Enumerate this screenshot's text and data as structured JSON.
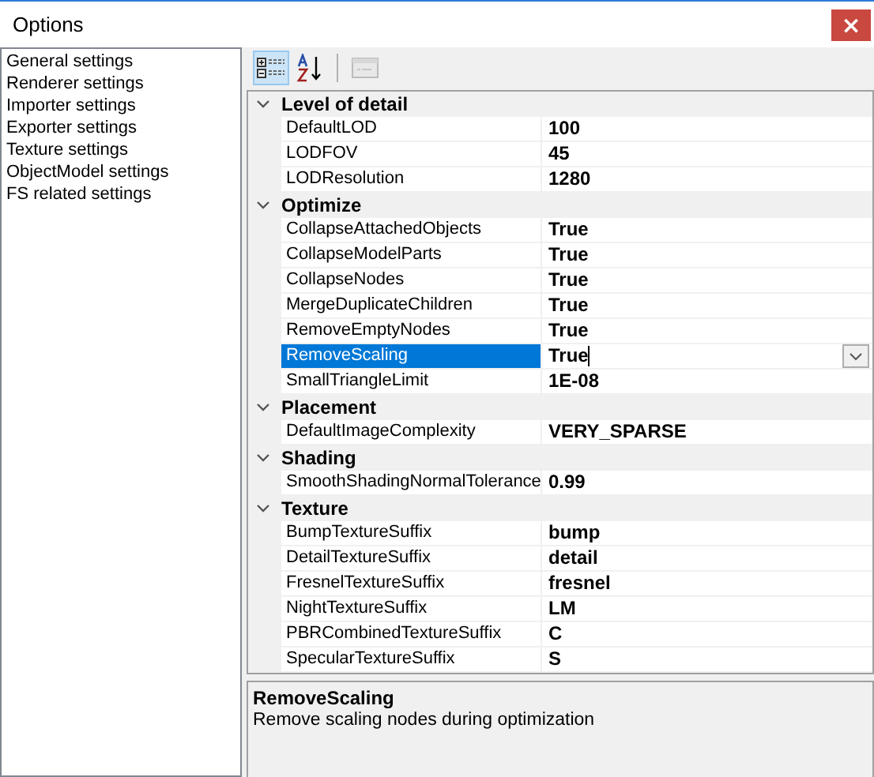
{
  "window": {
    "title": "Options",
    "close": "×"
  },
  "sidebar": {
    "items": [
      "General settings",
      "Renderer settings",
      "Importer settings",
      "Exporter settings",
      "Texture settings",
      "ObjectModel settings",
      "FS related settings"
    ]
  },
  "toolbar": [
    {
      "kind": "categorized",
      "selected": true,
      "disabled": false
    },
    {
      "kind": "alphabetical",
      "selected": false,
      "disabled": false
    },
    {
      "kind": "pages",
      "selected": false,
      "disabled": true
    }
  ],
  "grid": {
    "categories": [
      {
        "name": "Level of detail",
        "expanded": true,
        "properties": [
          {
            "name": "DefaultLOD",
            "value": "100",
            "selected": false
          },
          {
            "name": "LODFOV",
            "value": "45",
            "selected": false
          },
          {
            "name": "LODResolution",
            "value": "1280",
            "selected": false
          }
        ]
      },
      {
        "name": "Optimize",
        "expanded": true,
        "properties": [
          {
            "name": "CollapseAttachedObjects",
            "value": "True",
            "selected": false
          },
          {
            "name": "CollapseModelParts",
            "value": "True",
            "selected": false
          },
          {
            "name": "CollapseNodes",
            "value": "True",
            "selected": false
          },
          {
            "name": "MergeDuplicateChildren",
            "value": "True",
            "selected": false
          },
          {
            "name": "RemoveEmptyNodes",
            "value": "True",
            "selected": false
          },
          {
            "name": "RemoveScaling",
            "value": "True",
            "selected": true
          },
          {
            "name": "SmallTriangleLimit",
            "value": "1E-08",
            "selected": false
          }
        ]
      },
      {
        "name": "Placement",
        "expanded": true,
        "properties": [
          {
            "name": "DefaultImageComplexity",
            "value": "VERY_SPARSE",
            "selected": false
          }
        ]
      },
      {
        "name": "Shading",
        "expanded": true,
        "properties": [
          {
            "name": "SmoothShadingNormalTolerance",
            "value": "0.99",
            "selected": false
          }
        ]
      },
      {
        "name": "Texture",
        "expanded": true,
        "properties": [
          {
            "name": "BumpTextureSuffix",
            "value": "bump",
            "selected": false
          },
          {
            "name": "DetailTextureSuffix",
            "value": "detail",
            "selected": false
          },
          {
            "name": "FresnelTextureSuffix",
            "value": "fresnel",
            "selected": false
          },
          {
            "name": "NightTextureSuffix",
            "value": "LM",
            "selected": false
          },
          {
            "name": "PBRCombinedTextureSuffix",
            "value": "C",
            "selected": false
          },
          {
            "name": "SpecularTextureSuffix",
            "value": "S",
            "selected": false
          }
        ]
      }
    ]
  },
  "description": {
    "title": "RemoveScaling",
    "text": "Remove scaling nodes during optimization"
  }
}
